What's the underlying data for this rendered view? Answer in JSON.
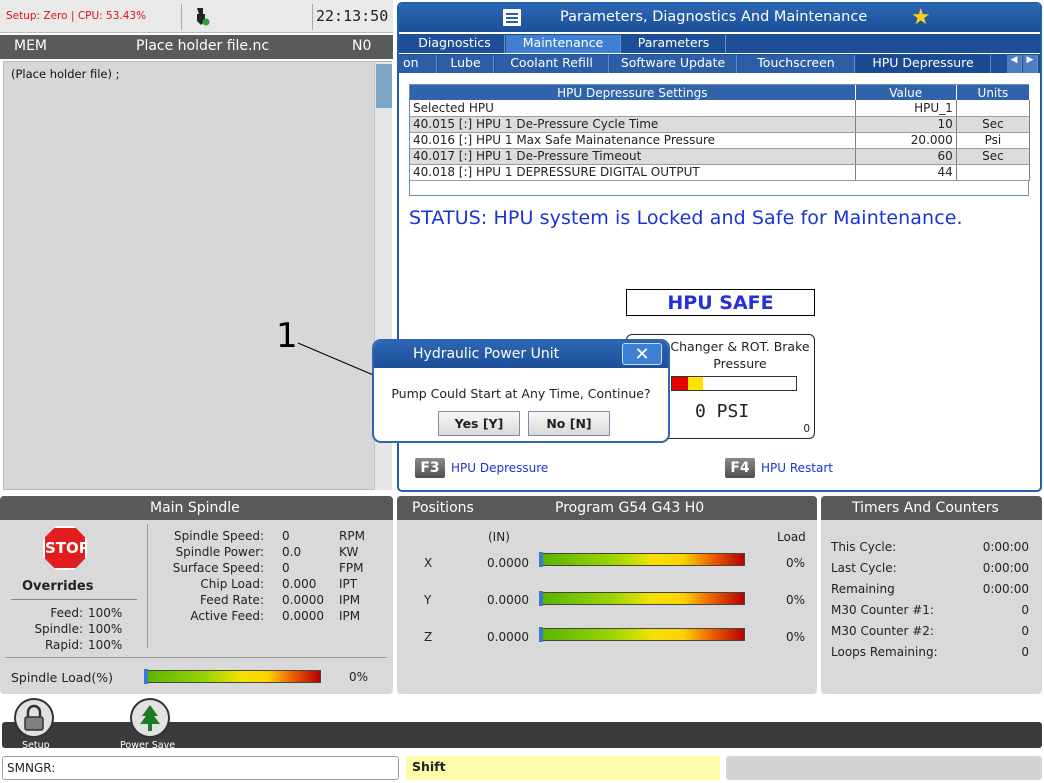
{
  "status_bar": {
    "setup_text": "Setup: Zero | CPU: 53.43%",
    "clock": "22:13:50"
  },
  "program": {
    "mode": "MEM",
    "file_name": "Place holder file.nc",
    "n_number": "N0",
    "line": "(Place holder file) ;"
  },
  "pdm": {
    "title": "Parameters, Diagnostics And Maintenance",
    "tabs_primary": [
      "Diagnostics",
      "Maintenance",
      "Parameters"
    ],
    "tabs_secondary": [
      "on",
      "Lube",
      "Coolant Refill",
      "Software Update",
      "Touchscreen",
      "HPU Depressure"
    ],
    "active_secondary": "HPU Depressure",
    "table": {
      "headers": [
        "HPU Depressure Settings",
        "Value",
        "Units"
      ],
      "rows": [
        {
          "setting": "Selected HPU",
          "value": "HPU_1",
          "units": ""
        },
        {
          "setting": "40.015 [:] HPU 1 De-Pressure Cycle Time",
          "value": "10",
          "units": "Sec"
        },
        {
          "setting": "40.016 [:] HPU 1 Max Safe Mainatenance Pressure",
          "value": "20.000",
          "units": "Psi"
        },
        {
          "setting": "40.017 [:] HPU 1 De-Pressure Timeout",
          "value": "60",
          "units": "Sec"
        },
        {
          "setting": "40.018 [:] HPU 1 DEPRESSURE DIGITAL OUTPUT",
          "value": "44",
          "units": ""
        }
      ]
    },
    "status_text": "STATUS:  HPU system is Locked and Safe for Maintenance.",
    "hpu_safe": "HPU SAFE",
    "gauge": {
      "label_line1": "Changer & ROT. Brake",
      "label_line2": "Pressure",
      "reading": "0 PSI",
      "scale_min": "0",
      "red_fraction": 0.13,
      "yellow_fraction": 0.12
    },
    "f3": {
      "key": "F3",
      "label": "HPU Depressure"
    },
    "f4": {
      "key": "F4",
      "label": "HPU Restart"
    }
  },
  "dialog": {
    "callout": "1",
    "title": "Hydraulic Power Unit",
    "close": "✕",
    "message": "Pump Could Start at Any Time, Continue?",
    "yes": "Yes [Y]",
    "no": "No [N]"
  },
  "spindle": {
    "title": "Main Spindle",
    "stop": "STOP",
    "overrides_title": "Overrides",
    "overrides": [
      {
        "label": "Feed:",
        "value": "100%"
      },
      {
        "label": "Spindle:",
        "value": "100%"
      },
      {
        "label": "Rapid:",
        "value": "100%"
      }
    ],
    "readouts": [
      {
        "label": "Spindle Speed:",
        "value": "0",
        "unit": "RPM"
      },
      {
        "label": "Spindle Power:",
        "value": "0.0",
        "unit": "KW"
      },
      {
        "label": "Surface Speed:",
        "value": "0",
        "unit": "FPM"
      },
      {
        "label": "Chip Load:",
        "value": "0.000",
        "unit": "IPT"
      },
      {
        "label": "Feed Rate:",
        "value": "0.0000",
        "unit": "IPM"
      },
      {
        "label": "Active Feed:",
        "value": "0.0000",
        "unit": "IPM"
      }
    ],
    "load_label": "Spindle Load(%)",
    "load_value": "0%"
  },
  "positions": {
    "title": "Positions",
    "program_title": "Program G54 G43 H0",
    "unit": "(IN)",
    "load_header": "Load",
    "axes": [
      {
        "axis": "X",
        "value": "0.0000",
        "load": "0%"
      },
      {
        "axis": "Y",
        "value": "0.0000",
        "load": "0%"
      },
      {
        "axis": "Z",
        "value": "0.0000",
        "load": "0%"
      }
    ]
  },
  "timers": {
    "title": "Timers And Counters",
    "rows": [
      {
        "label": "This Cycle:",
        "value": "0:00:00"
      },
      {
        "label": "Last Cycle:",
        "value": "0:00:00"
      },
      {
        "label": "Remaining",
        "value": "0:00:00"
      },
      {
        "label": "M30 Counter #1:",
        "value": "0"
      },
      {
        "label": "M30 Counter #2:",
        "value": "0"
      },
      {
        "label": "Loops Remaining:",
        "value": "0"
      }
    ]
  },
  "dock": {
    "setup_label": "Setup",
    "power_save_label": "Power Save"
  },
  "input_bar": {
    "command": "SMNGR:",
    "shift": "Shift"
  },
  "colors": {
    "header_blue": "#1d4f98",
    "status_blue": "#1a33d6",
    "stop_red": "#e21d1d",
    "shift_yellow": "#fefbaa"
  }
}
